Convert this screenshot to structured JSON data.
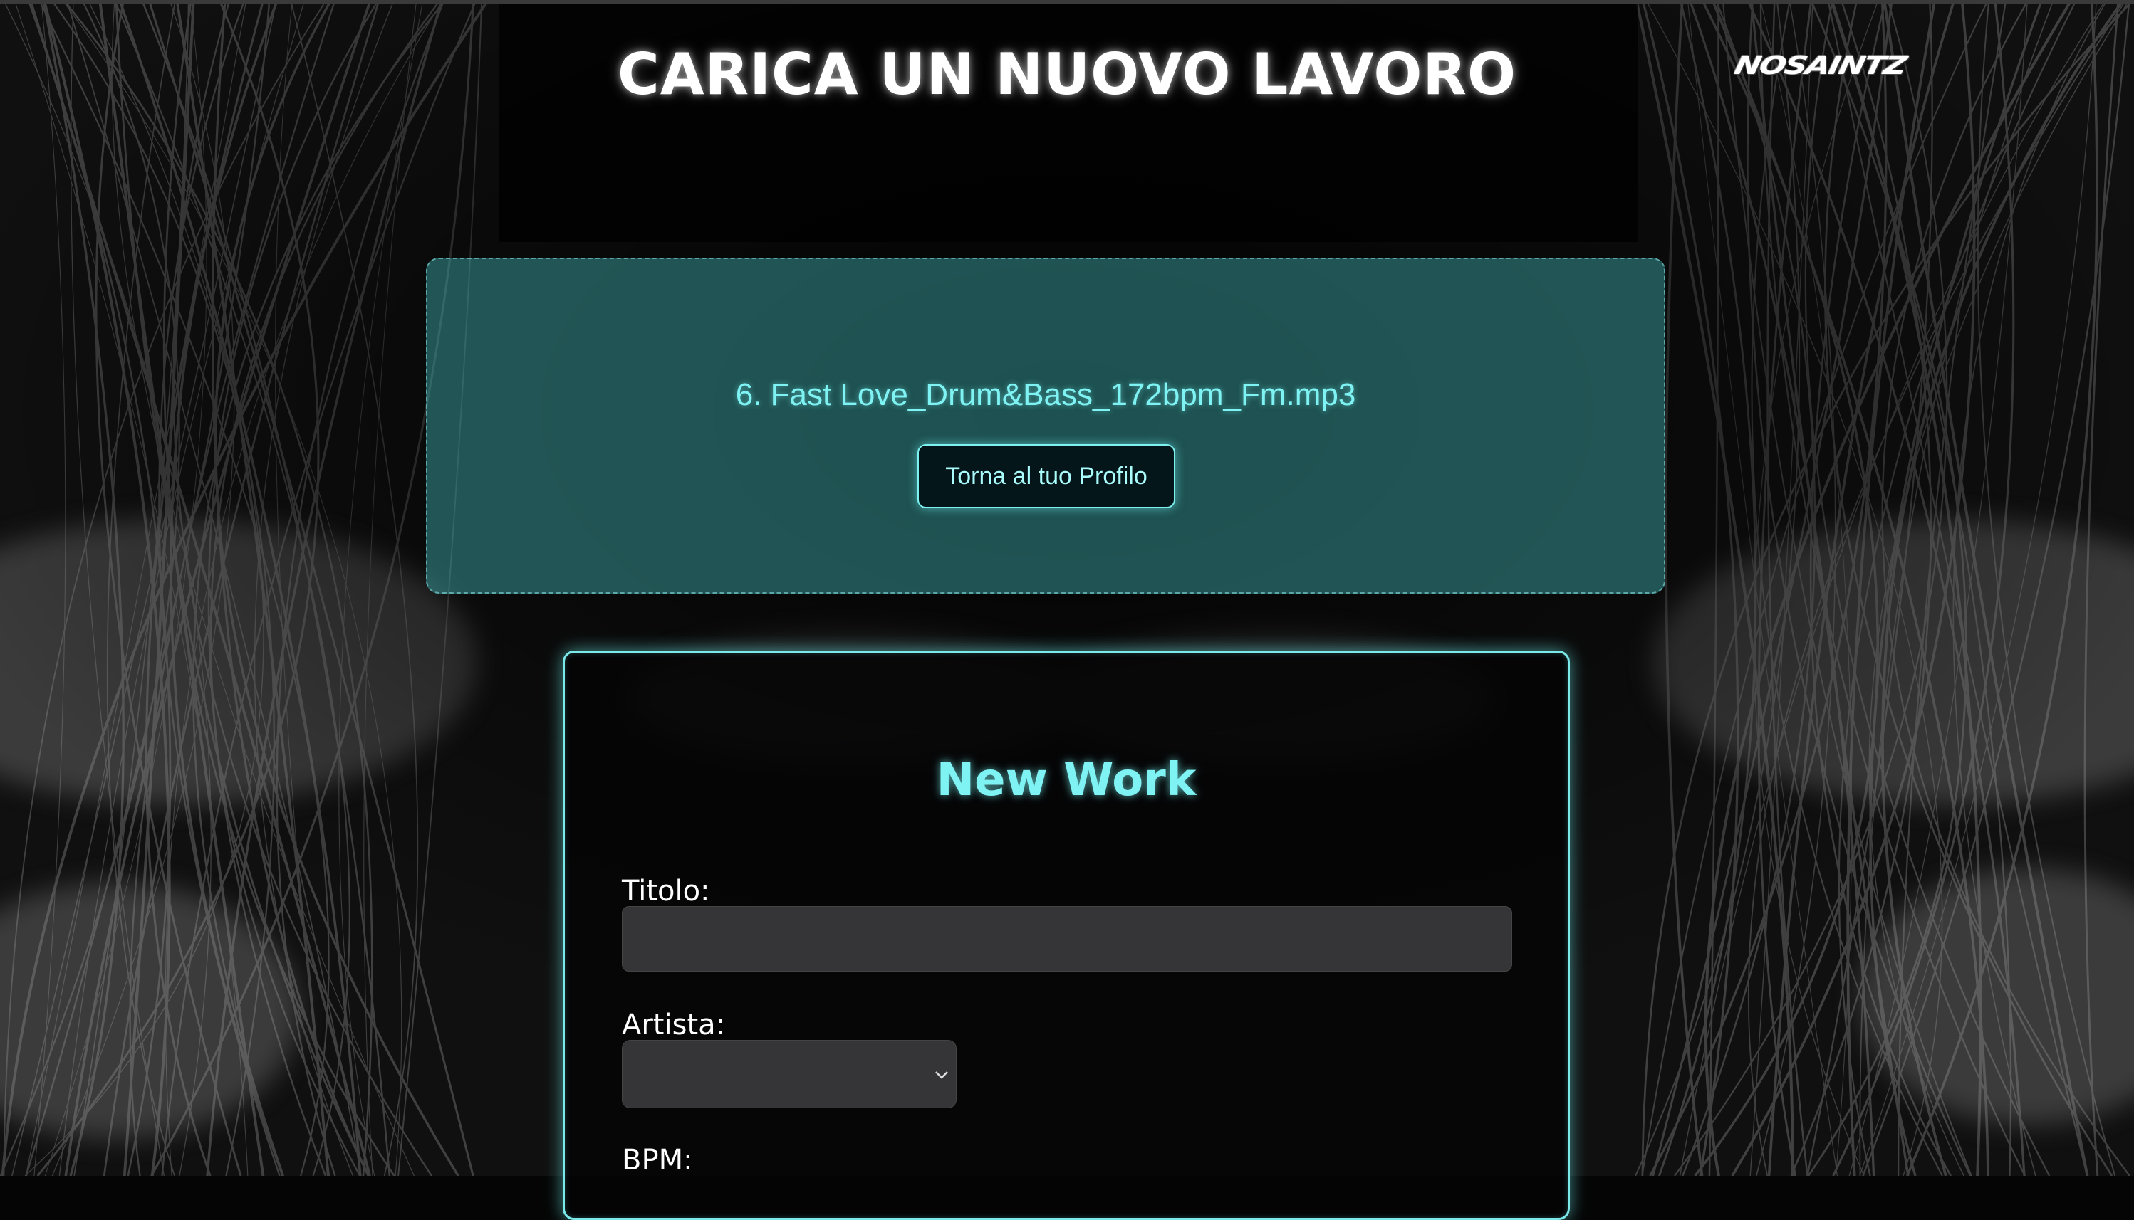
{
  "header": {
    "title": "CARICA UN NUOVO LAVORO",
    "logo_text": "NOSAINTZ"
  },
  "upload": {
    "file_name": "6. Fast Love_Drum&Bass_172bpm_Fm.mp3",
    "back_button_label": "Torna al tuo Profilo"
  },
  "form": {
    "title": "New Work",
    "fields": {
      "title_label": "Titolo:",
      "title_value": "",
      "artist_label": "Artista:",
      "artist_value": "",
      "bpm_label": "BPM:"
    }
  },
  "colors": {
    "accent": "#7ff3f3",
    "panel": "#2f7f82",
    "background": "#050505"
  }
}
